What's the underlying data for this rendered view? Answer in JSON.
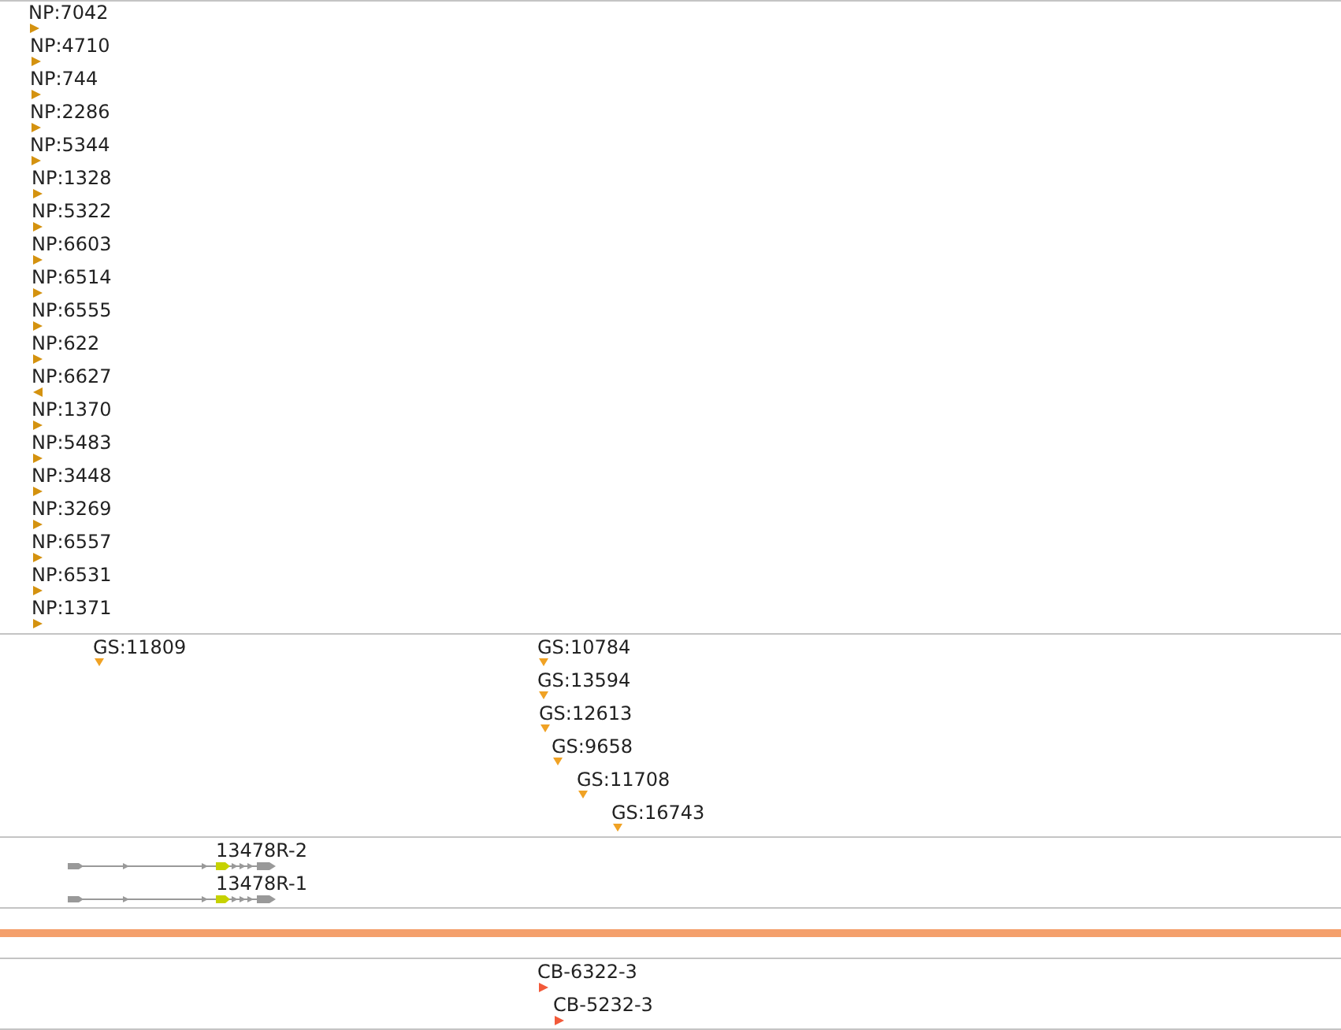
{
  "tracks": [
    {
      "kind": "markers",
      "color": "#d4920f",
      "features": [
        {
          "label": "NP:7042",
          "kind": "forward"
        },
        {
          "label": "NP:4710",
          "kind": "forward"
        },
        {
          "label": "NP:744",
          "kind": "forward"
        },
        {
          "label": "NP:2286",
          "kind": "forward"
        },
        {
          "label": "NP:5344",
          "kind": "forward"
        },
        {
          "label": "NP:1328",
          "kind": "forward"
        },
        {
          "label": "NP:5322",
          "kind": "forward"
        },
        {
          "label": "NP:6603",
          "kind": "forward"
        },
        {
          "label": "NP:6514",
          "kind": "forward"
        },
        {
          "label": "NP:6555",
          "kind": "forward"
        },
        {
          "label": "NP:622",
          "kind": "forward"
        },
        {
          "label": "NP:6627",
          "kind": "reverse"
        },
        {
          "label": "NP:1370",
          "kind": "forward"
        },
        {
          "label": "NP:5483",
          "kind": "forward"
        },
        {
          "label": "NP:3448",
          "kind": "forward"
        },
        {
          "label": "NP:3269",
          "kind": "forward"
        },
        {
          "label": "NP:6557",
          "kind": "forward"
        },
        {
          "label": "NP:6531",
          "kind": "forward"
        },
        {
          "label": "NP:1371",
          "kind": "forward"
        }
      ]
    },
    {
      "kind": "markers",
      "color": "#f0a224",
      "features": [
        {
          "label": "GS:11809",
          "kind": "site"
        },
        {
          "label": "GS:10784",
          "kind": "site"
        },
        {
          "label": "GS:13594",
          "kind": "site"
        },
        {
          "label": "GS:12613",
          "kind": "site"
        },
        {
          "label": "GS:9658",
          "kind": "site"
        },
        {
          "label": "GS:11708",
          "kind": "site"
        },
        {
          "label": "GS:16743",
          "kind": "site"
        }
      ]
    },
    {
      "kind": "transcripts",
      "transcripts": [
        {
          "label": "13478R-2"
        },
        {
          "label": "13478R-1"
        }
      ]
    },
    {
      "kind": "band",
      "color": "#f4a06c"
    },
    {
      "kind": "markers",
      "color": "#f25a3a",
      "features": [
        {
          "label": "CB-6322-3",
          "kind": "forward"
        },
        {
          "label": "CB-5232-3",
          "kind": "forward"
        }
      ]
    }
  ]
}
